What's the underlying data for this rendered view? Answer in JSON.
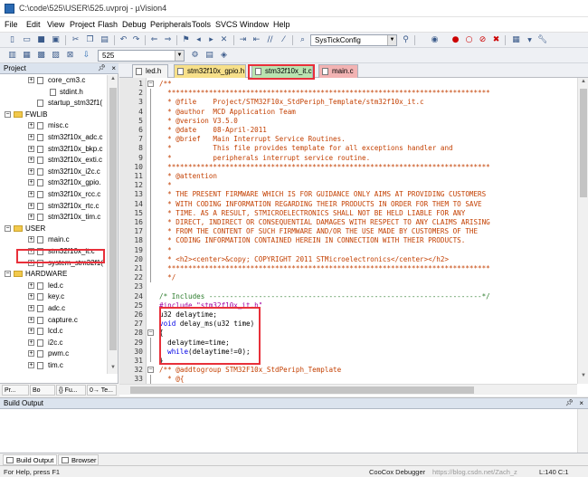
{
  "window": {
    "title": "C:\\code\\525\\USER\\525.uvproj - µVision4"
  },
  "menu": [
    "File",
    "Edit",
    "View",
    "Project",
    "Flash",
    "Debug",
    "Peripherals",
    "Tools",
    "SVCS",
    "Window",
    "Help"
  ],
  "toolbar": {
    "function_combo": "SysTickConfig",
    "target_combo": "525"
  },
  "project_panel": {
    "title": "Project",
    "tree": [
      {
        "label": "core_cm3.c",
        "level": 2,
        "type": "file",
        "expander": "+"
      },
      {
        "label": "stdint.h",
        "level": 3,
        "type": "file",
        "expander": ""
      },
      {
        "label": "startup_stm32f1(",
        "level": 2,
        "type": "file",
        "expander": ""
      },
      {
        "label": "FWLIB",
        "level": 1,
        "type": "group",
        "expander": "-"
      },
      {
        "label": "misc.c",
        "level": 2,
        "type": "file",
        "expander": "+"
      },
      {
        "label": "stm32f10x_adc.c",
        "level": 2,
        "type": "file",
        "expander": "+"
      },
      {
        "label": "stm32f10x_bkp.c",
        "level": 2,
        "type": "file",
        "expander": "+"
      },
      {
        "label": "stm32f10x_exti.c",
        "level": 2,
        "type": "file",
        "expander": "+"
      },
      {
        "label": "stm32f10x_i2c.c",
        "level": 2,
        "type": "file",
        "expander": "+"
      },
      {
        "label": "stm32f10x_gpio.",
        "level": 2,
        "type": "file",
        "expander": "+"
      },
      {
        "label": "stm32f10x_rcc.c",
        "level": 2,
        "type": "file",
        "expander": "+"
      },
      {
        "label": "stm32f10x_rtc.c",
        "level": 2,
        "type": "file",
        "expander": "+"
      },
      {
        "label": "stm32f10x_tim.c",
        "level": 2,
        "type": "file",
        "expander": "+"
      },
      {
        "label": "USER",
        "level": 1,
        "type": "group",
        "expander": "-"
      },
      {
        "label": "main.c",
        "level": 2,
        "type": "file",
        "expander": "+"
      },
      {
        "label": "stm32f10x_it.c",
        "level": 2,
        "type": "file",
        "expander": "+"
      },
      {
        "label": "system_stm32f1(",
        "level": 2,
        "type": "file",
        "expander": "+"
      },
      {
        "label": "HARDWARE",
        "level": 1,
        "type": "group",
        "expander": "-"
      },
      {
        "label": "led.c",
        "level": 2,
        "type": "file",
        "expander": "+"
      },
      {
        "label": "key.c",
        "level": 2,
        "type": "file",
        "expander": "+"
      },
      {
        "label": "adc.c",
        "level": 2,
        "type": "file",
        "expander": "+"
      },
      {
        "label": "capture.c",
        "level": 2,
        "type": "file",
        "expander": "+"
      },
      {
        "label": "lcd.c",
        "level": 2,
        "type": "file",
        "expander": "+"
      },
      {
        "label": "i2c.c",
        "level": 2,
        "type": "file",
        "expander": "+"
      },
      {
        "label": "pwm.c",
        "level": 2,
        "type": "file",
        "expander": "+"
      },
      {
        "label": "tim.c",
        "level": 2,
        "type": "file",
        "expander": "+"
      }
    ],
    "tabs": [
      "Pr...",
      "Bo",
      "{} Fu...",
      "0→ Te..."
    ]
  },
  "editor": {
    "tabs": [
      {
        "label": "led.h",
        "color": "#f4f4f4"
      },
      {
        "label": "stm32f10x_gpio.h",
        "color": "#f7e08a"
      },
      {
        "label": "stm32f10x_it.c",
        "color": "#b9e3b0",
        "active": true
      },
      {
        "label": "main.c",
        "color": "#f2b3b3"
      }
    ],
    "lines": [
      {
        "n": "1",
        "text": "/**",
        "cls": "c-comment",
        "fold": "-"
      },
      {
        "n": "2",
        "text": "  ******************************************************************************",
        "cls": "c-comment"
      },
      {
        "n": "3",
        "text": "  * @file    Project/STM32F10x_StdPeriph_Template/stm32f10x_it.c",
        "cls": "c-comment"
      },
      {
        "n": "4",
        "text": "  * @author  MCD Application Team",
        "cls": "c-comment"
      },
      {
        "n": "5",
        "text": "  * @version V3.5.0",
        "cls": "c-comment"
      },
      {
        "n": "6",
        "text": "  * @date    08-April-2011",
        "cls": "c-comment"
      },
      {
        "n": "7",
        "text": "  * @brief   Main Interrupt Service Routines.",
        "cls": "c-comment"
      },
      {
        "n": "8",
        "text": "  *          This file provides template for all exceptions handler and",
        "cls": "c-comment"
      },
      {
        "n": "9",
        "text": "  *          peripherals interrupt service routine.",
        "cls": "c-comment"
      },
      {
        "n": "10",
        "text": "  ******************************************************************************",
        "cls": "c-comment"
      },
      {
        "n": "11",
        "text": "  * @attention",
        "cls": "c-comment"
      },
      {
        "n": "12",
        "text": "  *",
        "cls": "c-comment"
      },
      {
        "n": "13",
        "text": "  * THE PRESENT FIRMWARE WHICH IS FOR GUIDANCE ONLY AIMS AT PROVIDING CUSTOMERS",
        "cls": "c-comment"
      },
      {
        "n": "14",
        "text": "  * WITH CODING INFORMATION REGARDING THEIR PRODUCTS IN ORDER FOR THEM TO SAVE",
        "cls": "c-comment"
      },
      {
        "n": "15",
        "text": "  * TIME. AS A RESULT, STMICROELECTRONICS SHALL NOT BE HELD LIABLE FOR ANY",
        "cls": "c-comment"
      },
      {
        "n": "16",
        "text": "  * DIRECT, INDIRECT OR CONSEQUENTIAL DAMAGES WITH RESPECT TO ANY CLAIMS ARISING",
        "cls": "c-comment"
      },
      {
        "n": "17",
        "text": "  * FROM THE CONTENT OF SUCH FIRMWARE AND/OR THE USE MADE BY CUSTOMERS OF THE",
        "cls": "c-comment"
      },
      {
        "n": "18",
        "text": "  * CODING INFORMATION CONTAINED HEREIN IN CONNECTION WITH THEIR PRODUCTS.",
        "cls": "c-comment"
      },
      {
        "n": "19",
        "text": "  *",
        "cls": "c-comment"
      },
      {
        "n": "20",
        "text": "  * <h2><center>&copy; COPYRIGHT 2011 STMicroelectronics</center></h2>",
        "cls": "c-comment"
      },
      {
        "n": "21",
        "text": "  ******************************************************************************",
        "cls": "c-comment"
      },
      {
        "n": "22",
        "text": "  */",
        "cls": "c-comment"
      },
      {
        "n": "23",
        "text": "",
        "cls": "c-norm"
      },
      {
        "n": "24",
        "text": "/* Includes ------------------------------------------------------------------*/",
        "cls": "c-section"
      },
      {
        "n": "25",
        "text": "#include \"stm32f10x_it.h\"",
        "cls": "c-pp"
      },
      {
        "n": "26",
        "text": "u32 delaytime;",
        "cls": "c-norm"
      },
      {
        "n": "27",
        "text": "void delay_ms(u32 time)",
        "cls": "c-kwline"
      },
      {
        "n": "28",
        "text": "{",
        "cls": "c-norm",
        "fold": "-"
      },
      {
        "n": "29",
        "text": "  delaytime=time;",
        "cls": "c-norm"
      },
      {
        "n": "30",
        "text": "  while(delaytime!=0);",
        "cls": "c-kwline2"
      },
      {
        "n": "31",
        "text": "}",
        "cls": "c-norm"
      },
      {
        "n": "32",
        "text": "/** @addtogroup STM32F10x_StdPeriph_Template",
        "cls": "c-comment",
        "fold": "-"
      },
      {
        "n": "33",
        "text": "  * @{",
        "cls": "c-comment"
      }
    ]
  },
  "build_output": {
    "title": "Build Output",
    "tabs": [
      "Build Output",
      "Browser"
    ]
  },
  "statusbar": {
    "help": "For Help, press F1",
    "debugger": "CooCox Debugger",
    "watermark": "https://blog.csdn.net/Zach_z",
    "position": "L:140 C:1"
  },
  "colors": {
    "highlight": "#e8303a",
    "comment": "#c33f00",
    "keyword": "#0000e6"
  }
}
